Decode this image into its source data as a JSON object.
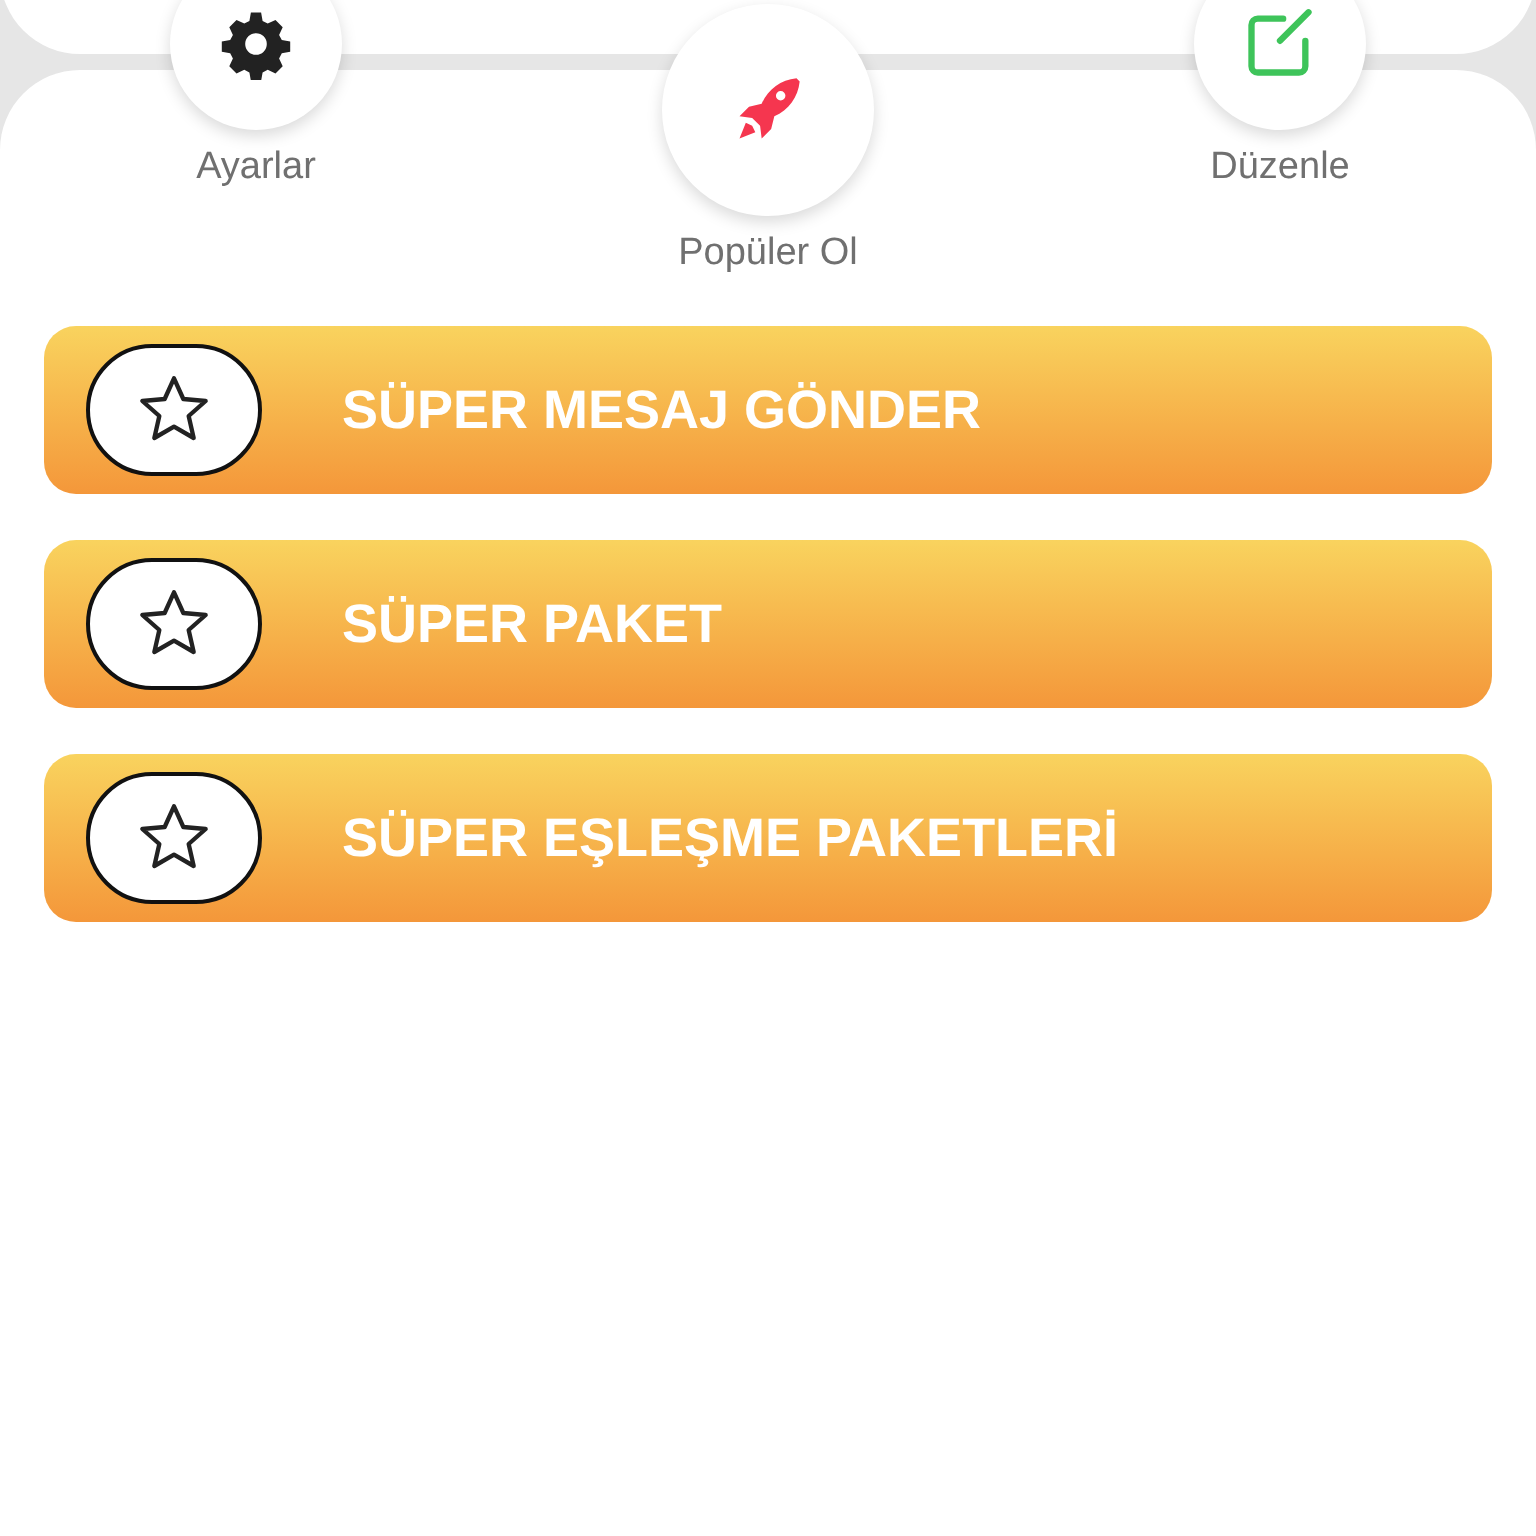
{
  "actions": [
    {
      "label": "Ayarlar",
      "kind": "secondary"
    },
    {
      "label": "Popüler Ol",
      "kind": "primary"
    },
    {
      "label": "Düzenle",
      "kind": "secondary"
    }
  ],
  "buttons": [
    {
      "label": "SÜPER MESAJ GÖNDER"
    },
    {
      "label": "SÜPER PAKET"
    },
    {
      "label": "SÜPER EŞLEŞME PAKETLERİ"
    }
  ]
}
